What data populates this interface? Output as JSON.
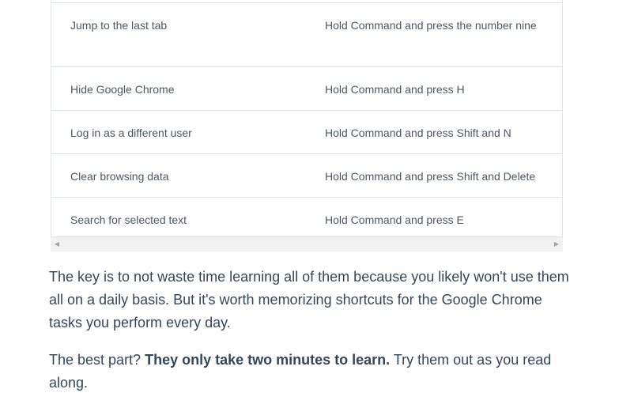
{
  "table": {
    "rows": [
      {
        "action": "Jump to the last tab",
        "shortcut": "Hold Command and press the number nine"
      },
      {
        "action": "Hide Google Chrome",
        "shortcut": "Hold Command and press H"
      },
      {
        "action": "Log in as a different user",
        "shortcut": "Hold Command and press Shift and N"
      },
      {
        "action": "Clear browsing data",
        "shortcut": "Hold Command and press Shift and Delete"
      },
      {
        "action": "Search for selected text",
        "shortcut": "Hold Command and press E"
      }
    ]
  },
  "scrollbar": {
    "left_arrow": "◀",
    "right_arrow": "▶"
  },
  "paragraphs": {
    "p1": "The key is to not waste time learning all of them because you likely won't use them all on a daily basis. But it's worth memorizing shortcuts for the Google Chrome tasks you perform every day.",
    "p2_start": "The best part? ",
    "p2_bold": "They only take two minutes to learn.",
    "p2_end": " Try them out as you read along."
  }
}
